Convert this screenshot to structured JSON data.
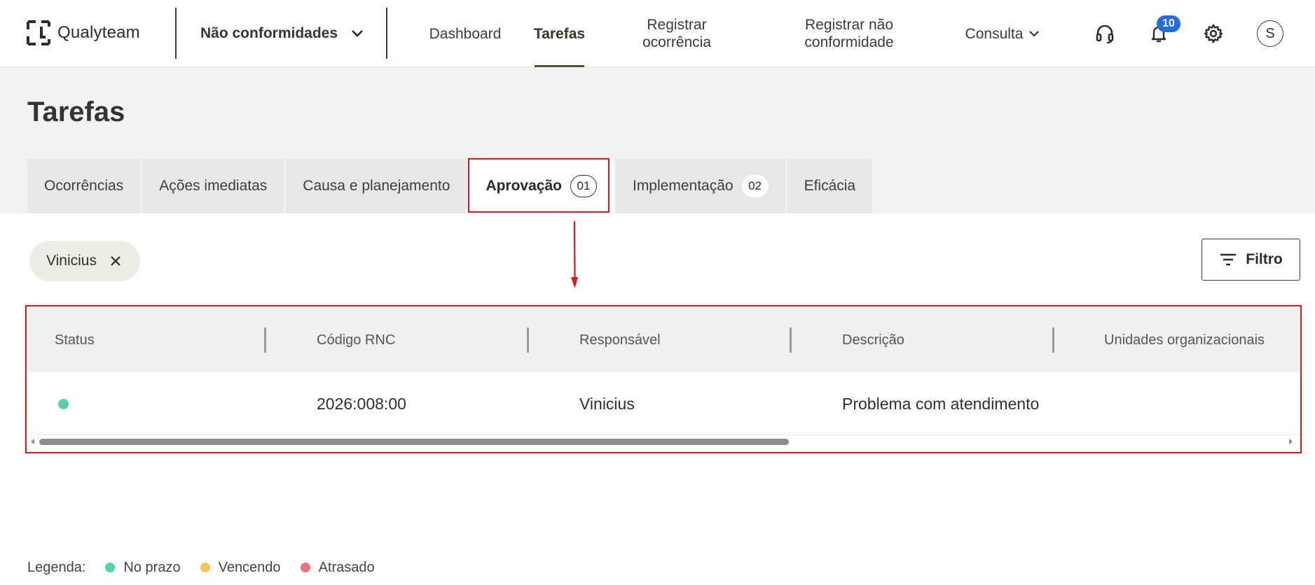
{
  "app": {
    "logo_text": "Qualyteam",
    "module_label": "Não conformidades"
  },
  "nav": {
    "items": [
      {
        "label": "Dashboard",
        "active": false
      },
      {
        "label": "Tarefas",
        "active": true
      },
      {
        "label": "Registrar\nocorrência",
        "active": false
      },
      {
        "label": "Registrar não\nconformidade",
        "active": false
      }
    ],
    "consulta_label": "Consulta",
    "notifications_count": "10",
    "avatar_initial": "S"
  },
  "page": {
    "title": "Tarefas"
  },
  "tabs": [
    {
      "label": "Ocorrências",
      "count": ""
    },
    {
      "label": "Ações imediatas",
      "count": ""
    },
    {
      "label": "Causa e planejamento",
      "count": ""
    },
    {
      "label": "Aprovação",
      "count": "01",
      "active": true
    },
    {
      "label": "Implementação",
      "count": "02"
    },
    {
      "label": "Eficácia",
      "count": ""
    }
  ],
  "filters": {
    "chip_label": "Vinicius",
    "filter_button_label": "Filtro"
  },
  "table": {
    "headers": [
      "Status",
      "Código RNC",
      "Responsável",
      "Descrição",
      "Unidades organizacionais"
    ],
    "rows": [
      {
        "status_color": "#4fd69c",
        "codigo": "2026:008:00",
        "responsavel": "Vinicius",
        "descricao": "Problema com atendimento",
        "unidades": ""
      }
    ],
    "scroll_thumb_fraction": 0.6
  },
  "legend": {
    "title": "Legenda:",
    "items": [
      {
        "label": "No prazo",
        "color": "#4fd69c"
      },
      {
        "label": "Vencendo",
        "color": "#f6c453"
      },
      {
        "label": "Atrasado",
        "color": "#e8737a"
      }
    ]
  },
  "colors": {
    "annotation": "#e3141c",
    "badge": "#1d6fe0",
    "active_underline": "#4a5a2e"
  }
}
